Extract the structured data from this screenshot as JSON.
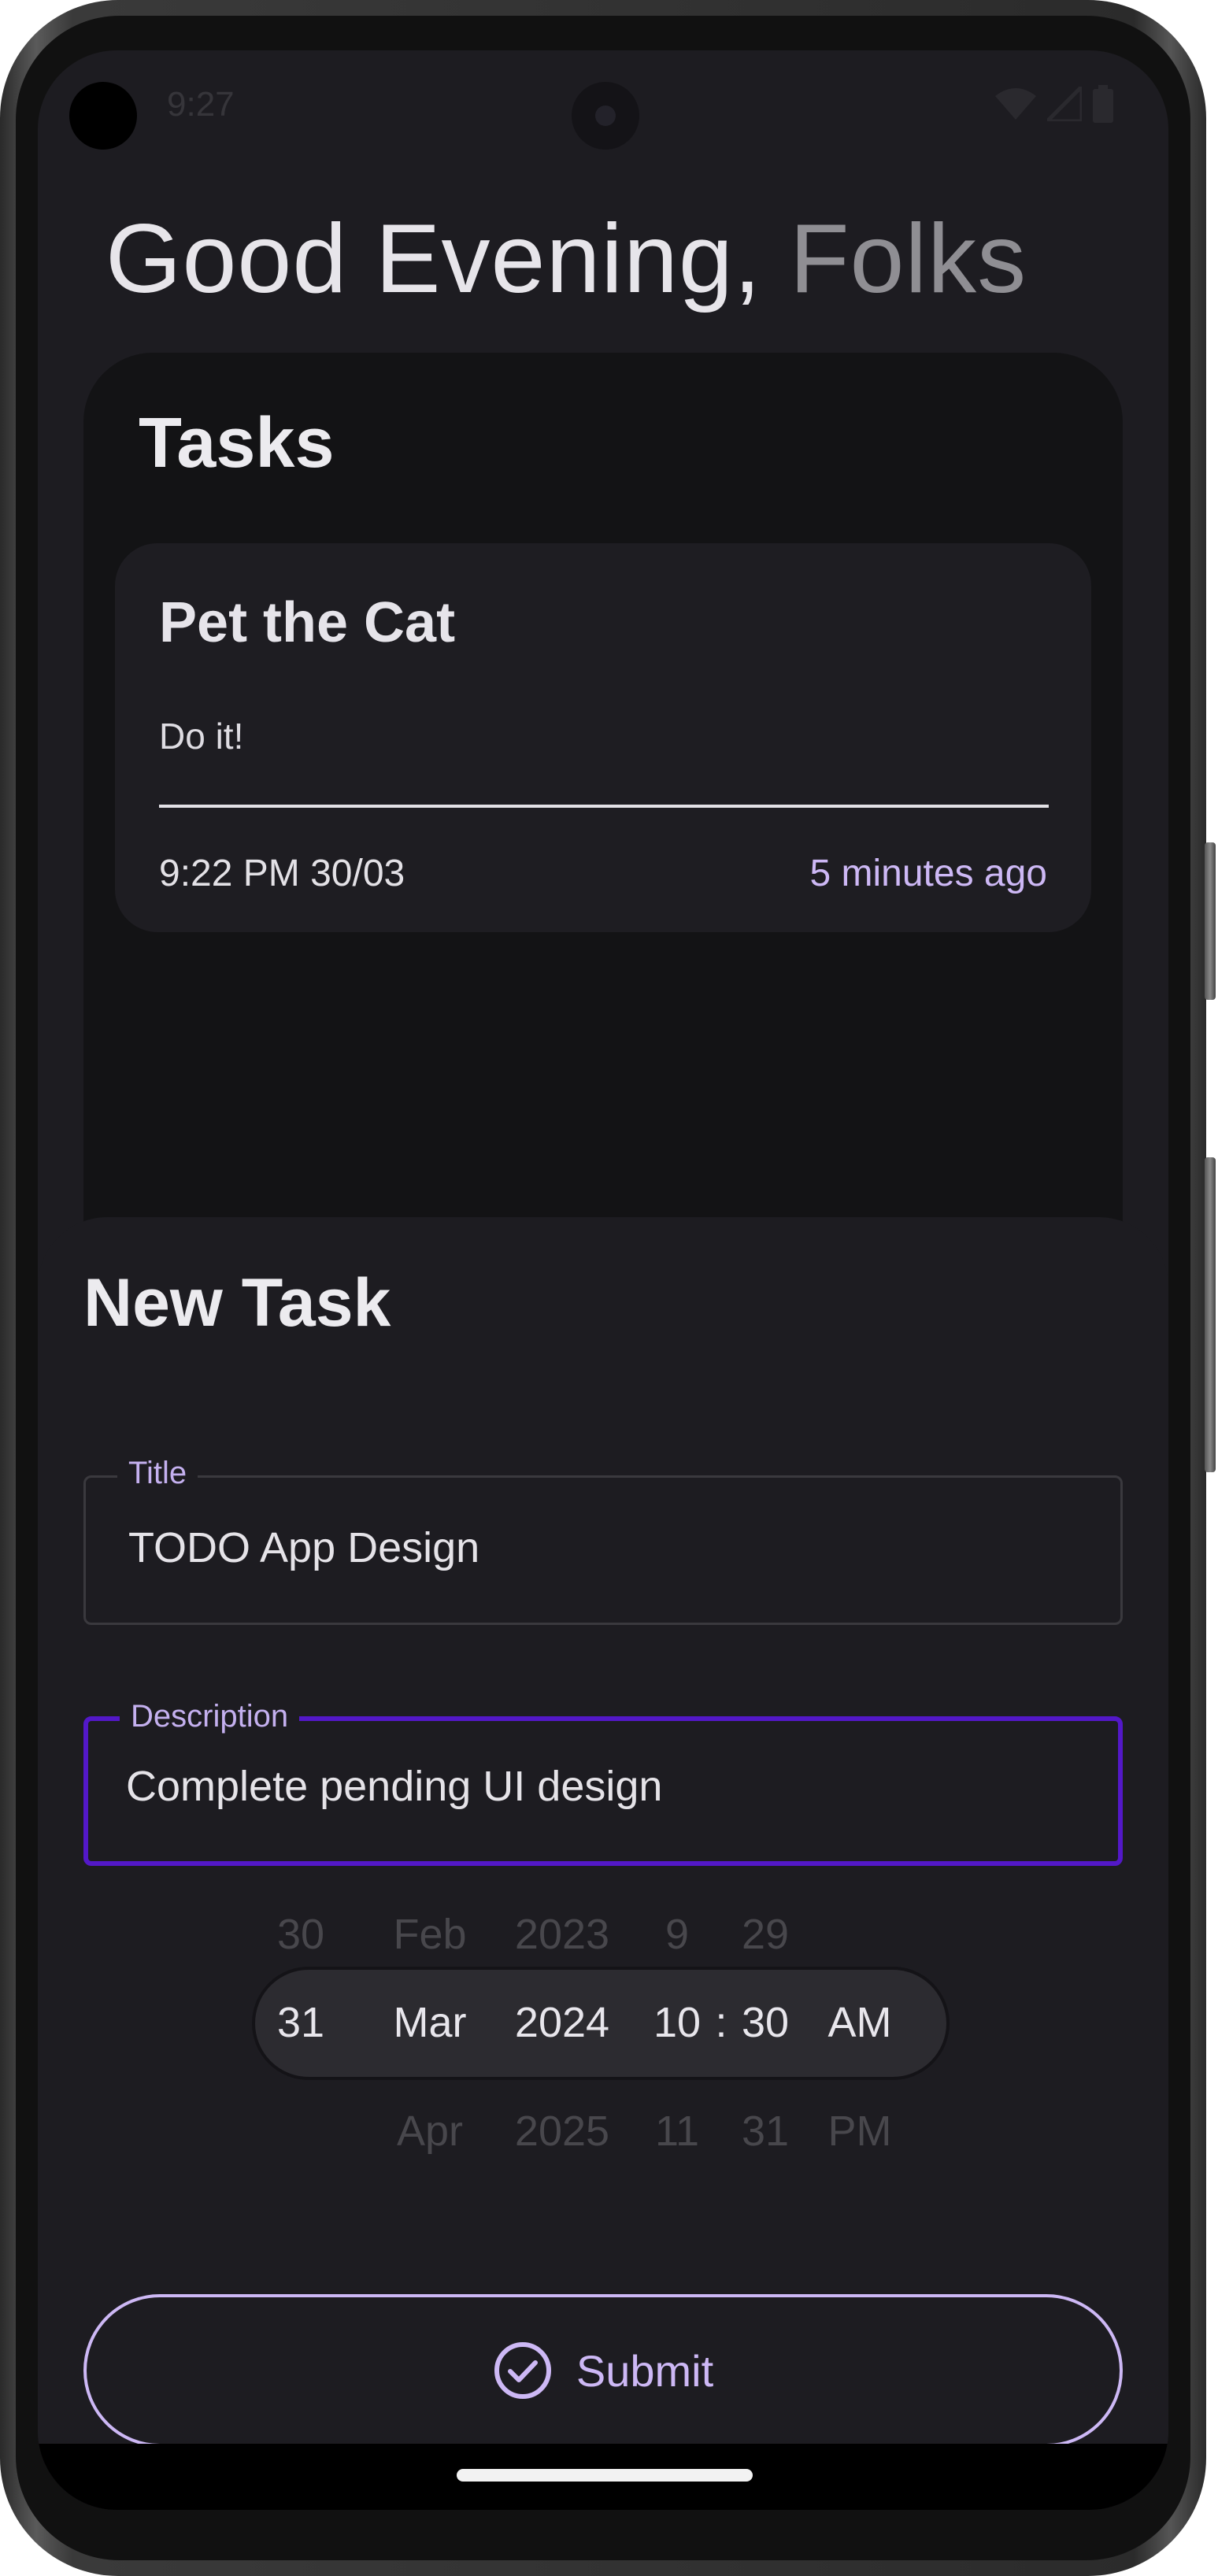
{
  "status_bar": {
    "time": "9:27",
    "icons": [
      "wifi-icon",
      "signal-icon",
      "battery-icon"
    ]
  },
  "greeting": {
    "primary": "Good Evening,",
    "secondary": "Folks"
  },
  "tasks": {
    "title": "Tasks",
    "items": [
      {
        "title": "Pet the Cat",
        "description": "Do it!",
        "datetime": "9:22 PM 30/03",
        "relative": "5 minutes ago"
      }
    ]
  },
  "new_task": {
    "title": "New Task",
    "title_field": {
      "label": "Title",
      "value": "TODO App Design"
    },
    "description_field": {
      "label": "Description",
      "value": "Complete pending UI design"
    },
    "picker": {
      "day": {
        "prev": "30",
        "selected": "31",
        "next": ""
      },
      "month": {
        "prev": "Feb",
        "selected": "Mar",
        "next": "Apr"
      },
      "year": {
        "prev": "2023",
        "selected": "2024",
        "next": "2025"
      },
      "hour": {
        "prev": "9",
        "selected": "10",
        "next": "11"
      },
      "separator": ":",
      "minute": {
        "prev": "29",
        "selected": "30",
        "next": "31"
      },
      "period": {
        "prev": "",
        "selected": "AM",
        "next": "PM"
      }
    },
    "submit_label": "Submit"
  },
  "colors": {
    "accent": "#cdb8f5",
    "focus_border": "#5318c8",
    "background": "#1d1c21",
    "panel": "#131315",
    "card": "#1e1d22"
  }
}
